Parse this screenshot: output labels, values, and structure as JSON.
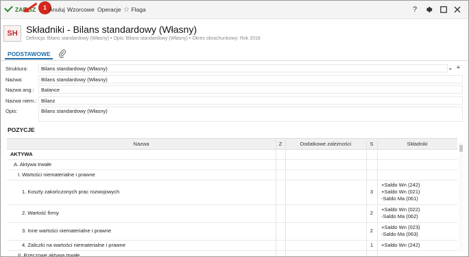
{
  "toolbar": {
    "save_label": "ZAPISZ",
    "badge": "1",
    "cancel_label": "Anuluj",
    "templates_label": "Wzorcowe",
    "operations_label": "Operacje",
    "flag_label": "Flaga",
    "help_glyph": "?"
  },
  "header": {
    "logo": "SH",
    "title": "Składniki - Bilans standardowy (Własny)",
    "subtitle": "Definicja: Bilans standardowy (Własny)  •  Opis: Bilans standardowy (Własny)  •  Okres obrachunkowy: Rok 2018"
  },
  "tabs": {
    "main_label": "PODSTAWOWE"
  },
  "form": {
    "structure_label": "Struktura:",
    "structure_value": "Bilans standardowy (Własny)",
    "name_label": "Nazwa:",
    "name_value": "Bilans standardowy (Własny)",
    "name_en_label": "Nazwa ang.:",
    "name_en_value": "Balance",
    "name_de_label": "Nazwa niem.:",
    "name_de_value": "Bilanz",
    "desc_label": "Opis:",
    "desc_value": "Bilans standardowy (Własny)"
  },
  "section_title": "POZYCJE",
  "table": {
    "columns": [
      "Nazwa",
      "Z",
      "Dodatkowe zależności",
      "S",
      "Składniki"
    ],
    "rows": [
      {
        "name": "AKTYWA",
        "level": 0,
        "bold": true,
        "s": "",
        "components": []
      },
      {
        "name": "A. Aktywa trwałe",
        "level": 1,
        "bold": false,
        "s": "",
        "components": []
      },
      {
        "name": "I. Wartości niematerialne i prawne",
        "level": 2,
        "bold": false,
        "s": "",
        "components": []
      },
      {
        "name": "1. Koszty zakończonych prac rozwojowych",
        "level": 3,
        "bold": false,
        "s": "3",
        "components": [
          "+Saldo Wn (242)",
          "+Saldo Wn (021)",
          "-Saldo Ma (061)"
        ]
      },
      {
        "name": "2. Wartość firmy",
        "level": 3,
        "bold": false,
        "s": "2",
        "components": [
          "+Saldo Wn (022)",
          "-Saldo Ma (062)"
        ]
      },
      {
        "name": "3. Inne wartości niematerialne i prawne",
        "level": 3,
        "bold": false,
        "s": "2",
        "components": [
          "+Saldo Wn (023)",
          "-Saldo Ma (063)"
        ]
      },
      {
        "name": "4. Zaliczki na wartości niematerialne i prawne",
        "level": 3,
        "bold": false,
        "s": "1",
        "components": [
          "+Saldo Wn (242)"
        ]
      },
      {
        "name": "II. Rzeczowe aktywa trwałe",
        "level": 2,
        "bold": false,
        "s": "",
        "components": []
      }
    ]
  },
  "colors": {
    "accent": "#1d6aa8",
    "save": "#2a7a2a",
    "badge": "#d9261c",
    "logo": "#c0262d"
  }
}
